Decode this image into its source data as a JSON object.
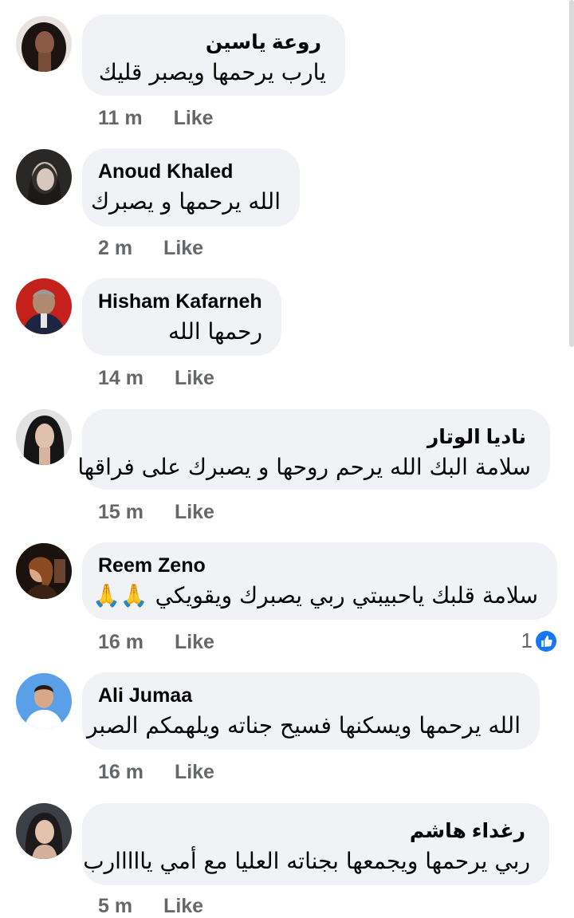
{
  "comments": [
    {
      "name": "روعة ياسين",
      "text": "يارب يرحمها ويصبر قليك",
      "time": "11 m",
      "like": "Like",
      "rtl_name": true
    },
    {
      "name": "Anoud Khaled",
      "text": "الله يرحمها و يصبرك",
      "time": "2 m",
      "like": "Like",
      "rtl_name": false
    },
    {
      "name": "Hisham Kafarneh",
      "text": "رحمها الله",
      "time": "14 m",
      "like": "Like",
      "rtl_name": false
    },
    {
      "name": "ناديا الوتار",
      "text": "سلامة البك الله يرحم روحها و يصبرك على فراقها",
      "time": "15 m",
      "like": "Like",
      "rtl_name": true
    },
    {
      "name": "Reem Zeno",
      "text": "سلامة قلبك ياحبيبتي ربي يصبرك ويقويكي 🙏🙏",
      "time": "16 m",
      "like": "Like",
      "rtl_name": false,
      "reactions": "1"
    },
    {
      "name": "Ali Jumaa",
      "text": "الله يرحمها ويسكنها فسيح جناته ويلهمكم الصبر",
      "time": "16 m",
      "like": "Like",
      "rtl_name": false
    },
    {
      "name": "رغداء هاشم",
      "text": "ربي يرحمها ويجمعها بجناته العليا مع أمي يااااارب",
      "time": "5 m",
      "like": "Like",
      "rtl_name": true
    }
  ],
  "colors": {
    "bubble": "#f0f2f5",
    "meta": "#65676b",
    "accent": "#1877f2"
  }
}
